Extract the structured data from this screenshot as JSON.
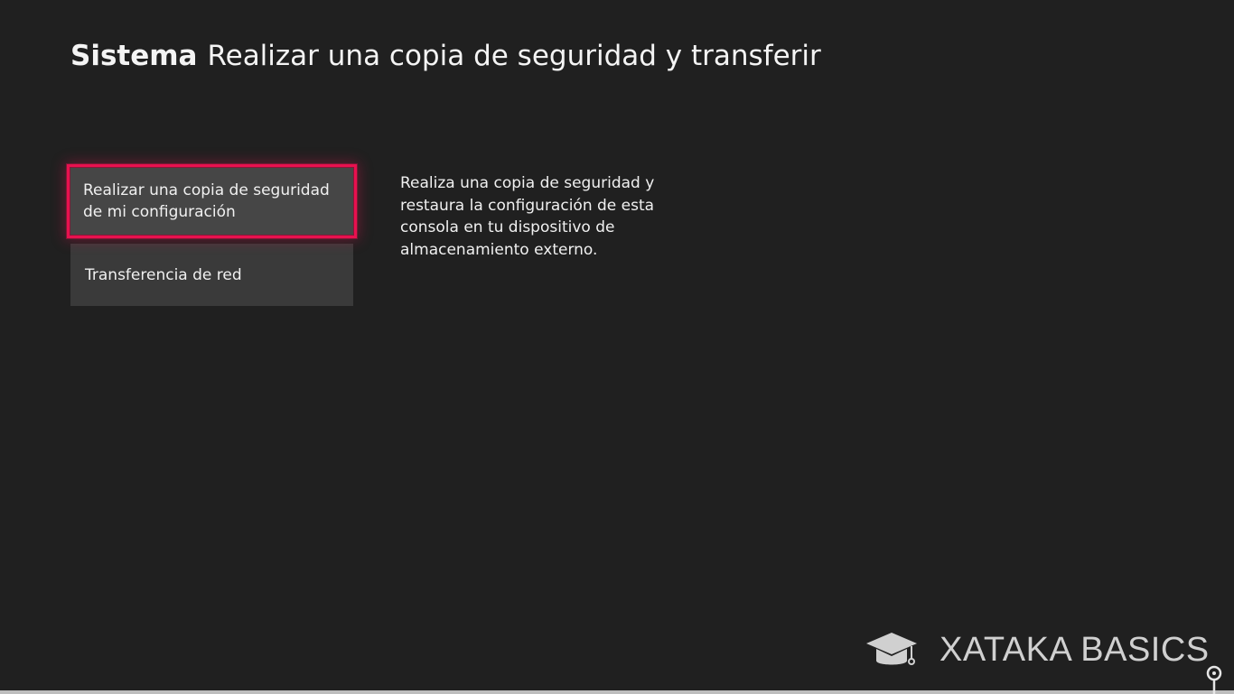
{
  "header": {
    "section": "Sistema",
    "title": "Realizar una copia de seguridad y transferir"
  },
  "menu": {
    "items": [
      {
        "label": "Realizar una copia de seguridad de mi configuración",
        "focused": true
      },
      {
        "label": "Transferencia de red",
        "focused": false
      }
    ]
  },
  "description": "Realiza una copia de seguridad y restaura la configuración de esta consola en tu dispositivo de almacenamiento externo.",
  "watermark": {
    "text": "XATAKA BASICS",
    "icon": "graduation-cap-icon"
  },
  "colors": {
    "background": "#202020",
    "focus_outline": "#e8114f",
    "tile": "#3a3a3a"
  }
}
